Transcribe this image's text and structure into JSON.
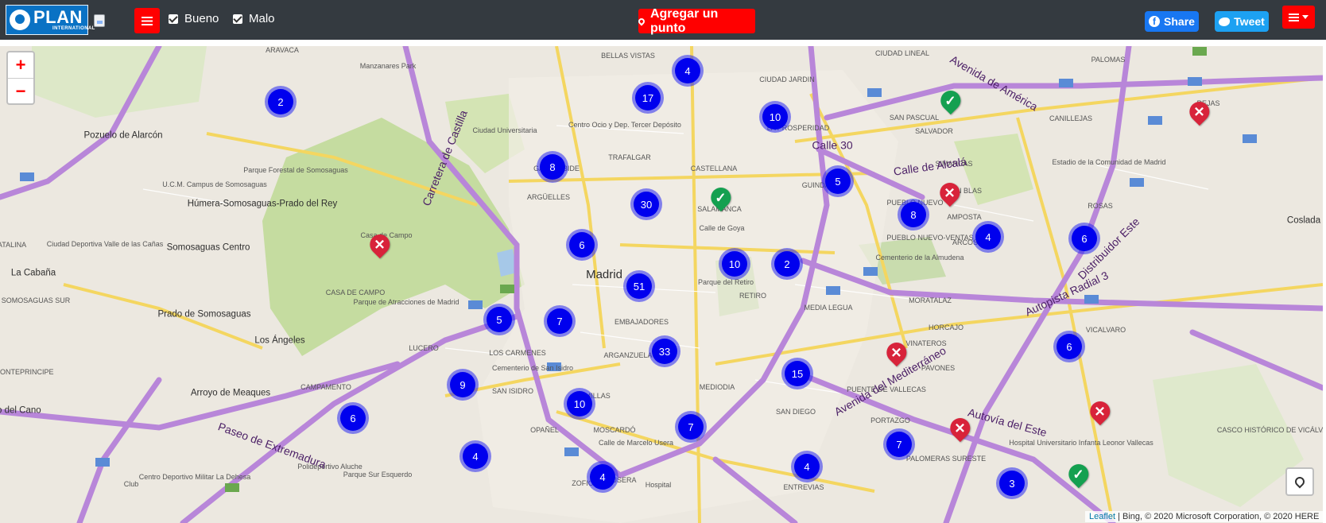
{
  "navbar": {
    "logo_text": "PLAN",
    "logo_sub": "INTERNATIONAL",
    "filters": [
      {
        "label": "Bueno",
        "checked": true
      },
      {
        "label": "Malo",
        "checked": true
      }
    ],
    "add_point_label": "Agregar un punto",
    "share_label": "Share",
    "tweet_label": "Tweet"
  },
  "map": {
    "zoom_in": "+",
    "zoom_out": "−",
    "attribution_link": "Leaflet",
    "attribution_text": " | Bing, © 2020 Microsoft Corporation, © 2020 HERE",
    "labels": [
      {
        "text": "ARAVACA",
        "size": "small"
      },
      {
        "text": "Manzanares Park",
        "size": "small"
      },
      {
        "text": "Pozuelo de Alarcón",
        "size": "normal"
      },
      {
        "text": "U.C.M. Campus de Somosaguas",
        "size": "small"
      },
      {
        "text": "Húmera-Somosaguas-Prado del Rey",
        "size": "normal"
      },
      {
        "text": "Ciudad Deportiva Valle de las Cañas",
        "size": "small"
      },
      {
        "text": "Somosaguas Centro",
        "size": "normal"
      },
      {
        "text": "La Cabaña",
        "size": "normal"
      },
      {
        "text": "SOMOSAGUAS SUR",
        "size": "small"
      },
      {
        "text": "Prado de Somosaguas",
        "size": "normal"
      },
      {
        "text": "Los Ángeles",
        "size": "normal"
      },
      {
        "text": "Arroyo de Meaques",
        "size": "normal"
      },
      {
        "text": "MONTEPRINCIPE",
        "size": "small"
      },
      {
        "text": "rro del Cano",
        "size": "normal"
      },
      {
        "text": "Parque Forestal de Somosaguas",
        "size": "small"
      },
      {
        "text": "Casa de Campo",
        "size": "small"
      },
      {
        "text": "CASA DE CAMPO",
        "size": "small"
      },
      {
        "text": "Parque de Atracciones de Madrid",
        "size": "small"
      },
      {
        "text": "CAMPAMENTO",
        "size": "small"
      },
      {
        "text": "Ciudad Universitaria",
        "size": "small"
      },
      {
        "text": "BELLAS VISTAS",
        "size": "small"
      },
      {
        "text": "Centro Ocio y Dep. Tercer Depósito",
        "size": "small"
      },
      {
        "text": "GAZTAMBIDE",
        "size": "small"
      },
      {
        "text": "TRAFALGAR",
        "size": "small"
      },
      {
        "text": "ARGÜELLES",
        "size": "small"
      },
      {
        "text": "Madrid",
        "size": "big"
      },
      {
        "text": "CASTELLANA",
        "size": "small"
      },
      {
        "text": "SALAMANCA",
        "size": "small"
      },
      {
        "text": "Calle de Goya",
        "size": "small"
      },
      {
        "text": "Parque del Retiro",
        "size": "small"
      },
      {
        "text": "RETIRO",
        "size": "small"
      },
      {
        "text": "EMBAJADORES",
        "size": "small"
      },
      {
        "text": "ARGANZUELA",
        "size": "small"
      },
      {
        "text": "LOS CARMENES",
        "size": "small"
      },
      {
        "text": "Cementerio de San Isidro",
        "size": "small"
      },
      {
        "text": "SAN ISIDRO",
        "size": "small"
      },
      {
        "text": "LUCERO",
        "size": "small"
      },
      {
        "text": "COMILLAS",
        "size": "small"
      },
      {
        "text": "MEDIODIA",
        "size": "small"
      },
      {
        "text": "OPAÑEL",
        "size": "small"
      },
      {
        "text": "MOSCARDÓ",
        "size": "small"
      },
      {
        "text": "Calle de Marcelo Usera",
        "size": "small"
      },
      {
        "text": "USERA",
        "size": "small"
      },
      {
        "text": "Hospital",
        "size": "small"
      },
      {
        "text": "ZOFIO",
        "size": "small"
      },
      {
        "text": "Polideportivo Aluche",
        "size": "small"
      },
      {
        "text": "Centro Deportivo Militar La Dehesa",
        "size": "small"
      },
      {
        "text": "Parque Sur Esquerdo",
        "size": "small"
      },
      {
        "text": "Club",
        "size": "small"
      },
      {
        "text": "CIUDAD LINEAL",
        "size": "small"
      },
      {
        "text": "CIUDAD JARDIN",
        "size": "small"
      },
      {
        "text": "LA PROSPERIDAD",
        "size": "small"
      },
      {
        "text": "SAN PASCUAL",
        "size": "small"
      },
      {
        "text": "SALVADOR",
        "size": "small"
      },
      {
        "text": "GUINDALERA",
        "size": "small"
      },
      {
        "text": "PUEBLO NUEVO",
        "size": "small"
      },
      {
        "text": "SIMANCAS",
        "size": "small"
      },
      {
        "text": "SAN BLAS",
        "size": "small"
      },
      {
        "text": "AMPOSTA",
        "size": "small"
      },
      {
        "text": "ARCOS",
        "size": "small"
      },
      {
        "text": "Cementerio de la Almudena",
        "size": "small"
      },
      {
        "text": "PUEBLO NUEVO-VENTAS",
        "size": "small"
      },
      {
        "text": "MORATALAZ",
        "size": "small"
      },
      {
        "text": "MEDIA LEGUA",
        "size": "small"
      },
      {
        "text": "HORCAJO",
        "size": "small"
      },
      {
        "text": "VINATEROS",
        "size": "small"
      },
      {
        "text": "PAVONES",
        "size": "small"
      },
      {
        "text": "PUENTE DE VALLECAS",
        "size": "small"
      },
      {
        "text": "SAN DIEGO",
        "size": "small"
      },
      {
        "text": "PORTAZGO",
        "size": "small"
      },
      {
        "text": "PALOMERAS SURESTE",
        "size": "small"
      },
      {
        "text": "ENTREVIAS",
        "size": "small"
      },
      {
        "text": "Hospital Universitario Infanta Leonor Vallecas",
        "size": "small"
      },
      {
        "text": "VICALVARO",
        "size": "small"
      },
      {
        "text": "CASCO HISTÓRICO DE VICÁLVARO",
        "size": "small"
      },
      {
        "text": "PALOMAS",
        "size": "small"
      },
      {
        "text": "CANILLEJAS",
        "size": "small"
      },
      {
        "text": "REJAS",
        "size": "small"
      },
      {
        "text": "Estadio de la Comunidad de Madrid",
        "size": "small"
      },
      {
        "text": "ROSAS",
        "size": "small"
      },
      {
        "text": "Coslada",
        "size": "normal"
      },
      {
        "text": "ATALINA",
        "size": "small"
      },
      {
        "text": "Calle 30",
        "size": "road"
      },
      {
        "text": "Carretera de Castilla",
        "size": "road"
      },
      {
        "text": "Avenida de América",
        "size": "road"
      },
      {
        "text": "Calle de Alcalá",
        "size": "road"
      },
      {
        "text": "Autopista Radial 3",
        "size": "road"
      },
      {
        "text": "Autovía del Este",
        "size": "road"
      },
      {
        "text": "Paseo de Extremadura",
        "size": "road"
      },
      {
        "text": "Distribuidor Este",
        "size": "road"
      },
      {
        "text": "Avenida del Mediterráneo",
        "size": "road"
      }
    ],
    "clusters": [
      "4",
      "17",
      "2",
      "10",
      "8",
      "30",
      "5",
      "6",
      "8",
      "4",
      "6",
      "10",
      "2",
      "51",
      "5",
      "7",
      "33",
      "15",
      "6",
      "9",
      "10",
      "7",
      "6",
      "4",
      "4",
      "7",
      "4",
      "3"
    ],
    "markers": [
      "good",
      "good",
      "good",
      "bad",
      "bad",
      "bad",
      "bad",
      "bad",
      "bad"
    ]
  }
}
